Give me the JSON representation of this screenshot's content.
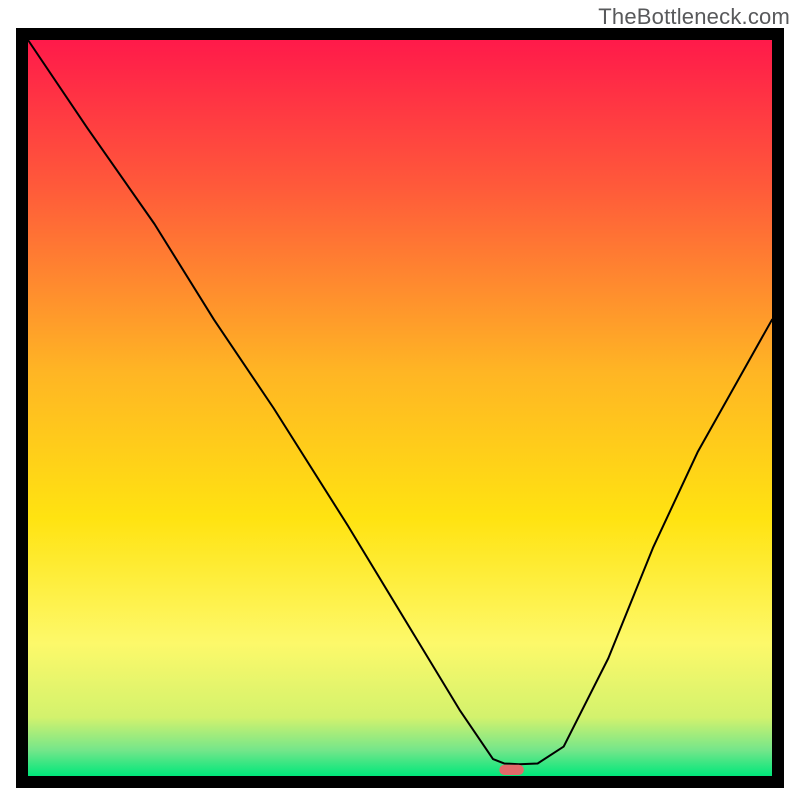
{
  "watermark": "TheBottleneck.com",
  "chart_data": {
    "type": "line",
    "title": "",
    "xlabel": "",
    "ylabel": "",
    "xlim": [
      0,
      100
    ],
    "ylim": [
      0,
      100
    ],
    "grid": false,
    "legend": false,
    "background_gradient": {
      "description": "Vertical gradient over plot area, top to bottom",
      "stops": [
        {
          "pos": 0.0,
          "color": "#ff1a4a"
        },
        {
          "pos": 0.2,
          "color": "#ff5a3a"
        },
        {
          "pos": 0.45,
          "color": "#ffb524"
        },
        {
          "pos": 0.65,
          "color": "#ffe311"
        },
        {
          "pos": 0.82,
          "color": "#fdf96a"
        },
        {
          "pos": 0.92,
          "color": "#d3f26d"
        },
        {
          "pos": 0.965,
          "color": "#74e68a"
        },
        {
          "pos": 1.0,
          "color": "#00e77b"
        }
      ]
    },
    "series": [
      {
        "name": "bottleneck-curve",
        "color": "#000000",
        "stroke_width": 2,
        "x": [
          0.0,
          8,
          17,
          25,
          33,
          43,
          52,
          58,
          62.5,
          64,
          66,
          68.5,
          72,
          78,
          84,
          90,
          100
        ],
        "y": [
          100.0,
          88,
          75,
          62,
          50,
          34,
          19,
          9,
          2.3,
          1.7,
          1.6,
          1.7,
          4,
          16,
          31,
          44,
          62
        ],
        "note": "y is percentage height above x-axis inside plot; valley bottom ~ (65, 1.6)"
      }
    ],
    "marker": {
      "name": "optimal-point-marker",
      "description": "Rounded pink-red capsule at valley minimum on x-axis",
      "x": 65,
      "y": 0,
      "color": "#e26a6a",
      "width_frac": 0.033,
      "height_frac": 0.014
    },
    "frame": {
      "color": "#000000",
      "stroke_width": 12,
      "note": "Thick black rectangular border around plot area"
    }
  }
}
